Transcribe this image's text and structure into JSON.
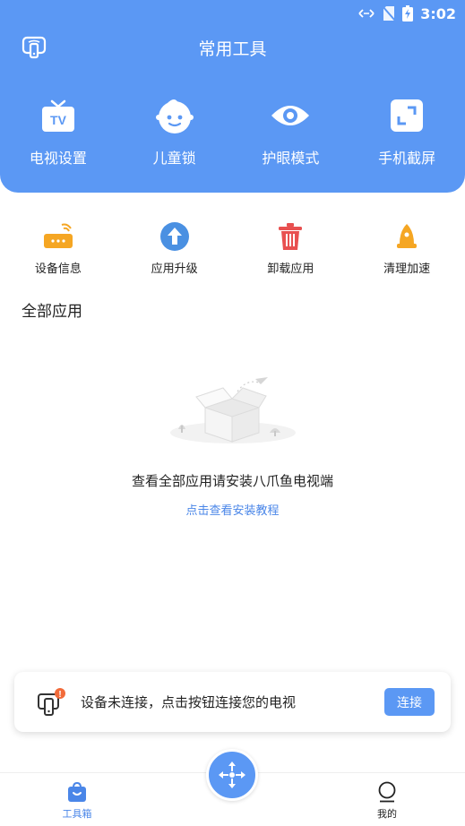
{
  "status_bar": {
    "time": "3:02",
    "icons": [
      "data-transfer-icon",
      "no-sim-icon",
      "battery-charging-icon"
    ]
  },
  "header": {
    "title": "常用工具",
    "cast_icon": "screen-cast-icon",
    "background_color": "#5b98f4"
  },
  "main_tools": [
    {
      "label": "电视设置",
      "icon": "tv-icon"
    },
    {
      "label": "儿童锁",
      "icon": "child-face-icon"
    },
    {
      "label": "护眼模式",
      "icon": "eye-icon"
    },
    {
      "label": "手机截屏",
      "icon": "screenshot-icon"
    }
  ],
  "secondary_tools": [
    {
      "label": "设备信息",
      "icon": "router-icon",
      "color": "#f5a623"
    },
    {
      "label": "应用升级",
      "icon": "upgrade-arrow-icon",
      "color": "#4a90e2"
    },
    {
      "label": "卸载应用",
      "icon": "trash-icon",
      "color": "#e85050"
    },
    {
      "label": "清理加速",
      "icon": "bell-rocket-icon",
      "color": "#f5a623"
    }
  ],
  "all_apps": {
    "title": "全部应用",
    "empty_message": "查看全部应用请安装八爪鱼电视端",
    "tutorial_link": "点击查看安装教程"
  },
  "connection_card": {
    "message": "设备未连接，点击按钮连接您的电视",
    "button_label": "连接",
    "badge": "!"
  },
  "tabbar": {
    "tabs": [
      {
        "label": "工具箱",
        "icon": "toolbox-bag-icon",
        "active": true
      },
      {
        "label": "我的",
        "icon": "profile-icon",
        "active": false
      }
    ],
    "center_button_icon": "remote-dpad-icon",
    "accent_color": "#4a86e8"
  }
}
